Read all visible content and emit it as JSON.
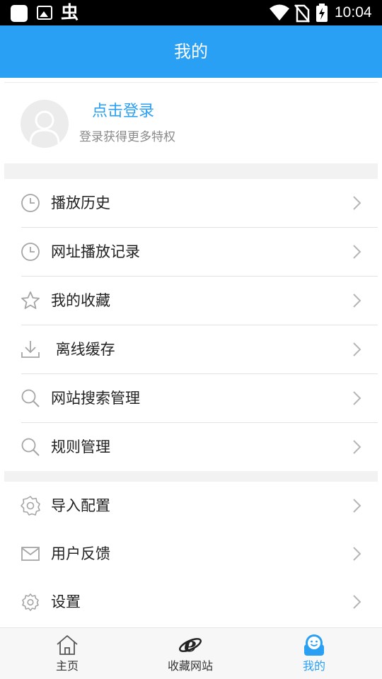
{
  "status_bar": {
    "time": "10:04",
    "app_glyph": "虫"
  },
  "header": {
    "title": "我的"
  },
  "profile": {
    "login_link": "点击登录",
    "subtitle": "登录获得更多特权"
  },
  "menu_group_1": [
    {
      "icon": "clock-icon",
      "label": "播放历史"
    },
    {
      "icon": "clock-icon",
      "label": "网址播放记录"
    },
    {
      "icon": "star-icon",
      "label": "我的收藏"
    },
    {
      "icon": "download-icon",
      "label": " 离线缓存"
    },
    {
      "icon": "search-icon",
      "label": "网站搜索管理"
    },
    {
      "icon": "search-icon",
      "label": "规则管理"
    }
  ],
  "menu_group_2": [
    {
      "icon": "gear-icon",
      "label": "导入配置"
    },
    {
      "icon": "mail-icon",
      "label": "用户反馈"
    },
    {
      "icon": "gear-icon",
      "label": "设置"
    }
  ],
  "bottom_nav": [
    {
      "icon": "home-icon",
      "label": "主页",
      "active": false
    },
    {
      "icon": "browser-e-icon",
      "label": "收藏网站",
      "active": false
    },
    {
      "icon": "smiley-profile-icon",
      "label": "我的",
      "active": true
    }
  ],
  "colors": {
    "accent": "#2aa0f5",
    "separator": "#f2f2f2",
    "icon_gray": "#a5a5a5"
  }
}
